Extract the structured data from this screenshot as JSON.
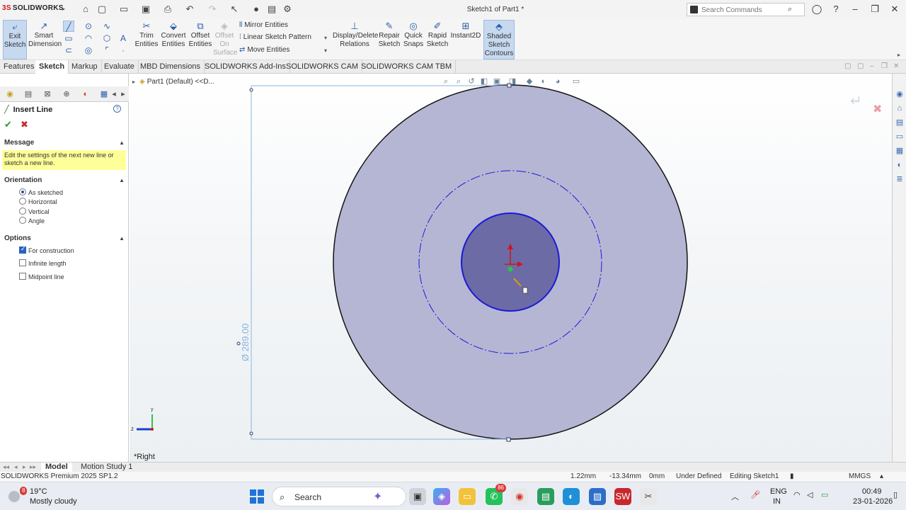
{
  "titlebar": {
    "logo_ds": "3S",
    "logo_text": "SOLIDWORKS",
    "doc_title": "Sketch1 of Part1 *",
    "search_placeholder": "Search Commands"
  },
  "ribbon": {
    "exit_sketch": [
      "Exit",
      "Sketch"
    ],
    "smart_dimension": [
      "Smart",
      "Dimension"
    ],
    "trim_entities": [
      "Trim",
      "Entities"
    ],
    "convert_entities": [
      "Convert",
      "Entities"
    ],
    "offset_entities": [
      "Offset",
      "Entities"
    ],
    "offset_on_surface": [
      "Offset",
      "On",
      "Surface"
    ],
    "mirror_entities": "Mirror Entities",
    "linear_sketch_pattern": "Linear Sketch Pattern",
    "move_entities": "Move Entities",
    "display_delete_relations": [
      "Display/Delete",
      "Relations"
    ],
    "repair_sketch": [
      "Repair",
      "Sketch"
    ],
    "quick_snaps": [
      "Quick",
      "Snaps"
    ],
    "rapid_sketch": [
      "Rapid",
      "Sketch"
    ],
    "instant2d": "Instant2D",
    "shaded_sketch_contours": [
      "Shaded",
      "Sketch",
      "Contours"
    ]
  },
  "tabs": [
    "Features",
    "Sketch",
    "Markup",
    "Evaluate",
    "MBD Dimensions",
    "SOLIDWORKS Add-Ins",
    "SOLIDWORKS CAM",
    "SOLIDWORKS CAM TBM"
  ],
  "property_manager": {
    "title": "Insert Line",
    "message_head": "Message",
    "message_text": "Edit the settings of the next new line or sketch a new line.",
    "orientation_head": "Orientation",
    "orientation_options": [
      "As sketched",
      "Horizontal",
      "Vertical",
      "Angle"
    ],
    "options_head": "Options",
    "options": [
      {
        "label": "For construction",
        "checked": true
      },
      {
        "label": "Infinite length",
        "checked": false
      },
      {
        "label": "Midpoint line",
        "checked": false
      }
    ]
  },
  "graphics": {
    "tree_flyout": "Part1 (Default) <<D...",
    "view_name": "*Right",
    "dimension_value": "289.00",
    "dimension_symbol": "Ø",
    "axis_z": "z"
  },
  "bottom_tabs": [
    "Model",
    "Motion Study 1"
  ],
  "status": {
    "product": "SOLIDWORKS Premium 2025 SP1.2",
    "x": "1.22mm",
    "y": "-13.34mm",
    "z": "0mm",
    "state": "Under Defined",
    "editing": "Editing Sketch1",
    "units": "MMGS"
  },
  "taskbar": {
    "weather_badge": "8",
    "weather_temp": "19°C",
    "weather_desc": "Mostly cloudy",
    "search": "Search",
    "whatsapp_badge": "86",
    "lang1": "ENG",
    "lang2": "IN",
    "time": "00:49",
    "date": "23-01-2026"
  },
  "colors": {
    "disk_outer": "#b5b6d4",
    "disk_inner": "#6c6ba5",
    "sketch_blue": "#1a1ad6",
    "accent_red": "#d4131b"
  }
}
